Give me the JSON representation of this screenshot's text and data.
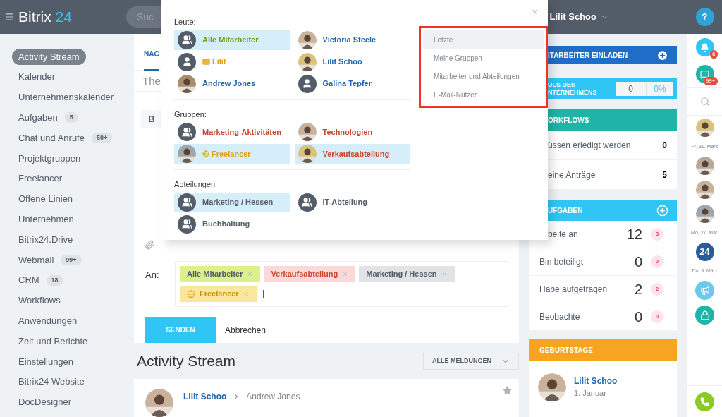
{
  "header": {
    "logo_name": "Bitrix",
    "logo_number": "24",
    "search_placeholder": "Suc",
    "user_name": "Lilit Schoo",
    "help": "?"
  },
  "sidebar": {
    "items": [
      {
        "label": "Activity Stream",
        "selected": true
      },
      {
        "label": "Kalender",
        "selected": false
      },
      {
        "label": "Unternehmenskalender",
        "selected": false
      },
      {
        "label": "Aufgaben",
        "counter": "5",
        "selected": false
      },
      {
        "label": "Chat und Anrufe",
        "counter": "50+",
        "selected": false
      },
      {
        "label": "Projektgruppen",
        "selected": false
      },
      {
        "label": "Freelancer",
        "selected": false
      },
      {
        "label": "Offene Linien",
        "selected": false
      },
      {
        "label": "Unternehmen",
        "selected": false
      },
      {
        "label": "Bitrix24.Drive",
        "selected": false
      },
      {
        "label": "Webmail",
        "counter": "99+",
        "selected": false
      },
      {
        "label": "CRM",
        "counter": "18",
        "selected": false
      },
      {
        "label": "Workflows",
        "selected": false
      },
      {
        "label": "Anwendungen",
        "selected": false
      },
      {
        "label": "Zeit und Berichte",
        "selected": false
      },
      {
        "label": "Einstellungen",
        "selected": false
      },
      {
        "label": "Bitrix24 Website",
        "selected": false
      },
      {
        "label": "DocDesigner",
        "selected": false
      }
    ]
  },
  "composer": {
    "tab": "NAC",
    "title_placeholder": "The",
    "toolbar_button": "B",
    "recipients_label": "An:",
    "recipients": [
      {
        "label": "Alle Mitarbeiter",
        "kind": "all"
      },
      {
        "label": "Verkaufsabteilung",
        "kind": "group"
      },
      {
        "label": "Marketing / Hessen",
        "kind": "department"
      },
      {
        "label": "Freelancer",
        "kind": "extranet"
      }
    ],
    "send": "SENDEN",
    "cancel": "Abbrechen"
  },
  "feed": {
    "title": "Activity Stream",
    "filter": "ALLE MELDUNGEN",
    "post": {
      "author": "Lilit Schoo",
      "recipient": "Andrew Jones"
    }
  },
  "popup": {
    "close": "×",
    "sections": [
      {
        "title": "Leute:",
        "items": [
          {
            "label": "Alle Mitarbeiter",
            "kind": "all",
            "avatar": {
              "kind": "group"
            },
            "selected": true
          },
          {
            "label": "Victoria Steele",
            "kind": "user",
            "selected": false
          },
          {
            "label": "Lilit",
            "kind": "email-user",
            "avatar": {
              "kind": "person"
            },
            "selected": false
          },
          {
            "label": "Lilit Schoo",
            "kind": "user",
            "selected": false
          },
          {
            "label": "Andrew Jones",
            "kind": "user",
            "selected": false
          },
          {
            "label": "Galina Tepfer",
            "kind": "user",
            "avatar": {
              "kind": "person"
            },
            "selected": false
          }
        ]
      },
      {
        "title": "Gruppen:",
        "items": [
          {
            "label": "Marketing-Aktivitäten",
            "kind": "group",
            "avatar": {
              "kind": "group"
            },
            "selected": false
          },
          {
            "label": "Technologien",
            "kind": "group",
            "selected": false
          },
          {
            "label": "Freelancer",
            "kind": "extranet-group",
            "selected": true
          },
          {
            "label": "Verkaufsabteilung",
            "kind": "group",
            "selected": true
          }
        ]
      },
      {
        "title": "Abteilungen:",
        "items": [
          {
            "label": "Marketing / Hessen",
            "kind": "department",
            "avatar": {
              "kind": "group"
            },
            "selected": true
          },
          {
            "label": "IT-Abteilung",
            "kind": "department",
            "avatar": {
              "kind": "group"
            },
            "selected": false
          },
          {
            "label": "Buchhaltung",
            "kind": "department",
            "avatar": {
              "kind": "group"
            },
            "selected": false
          }
        ]
      }
    ],
    "tabs": [
      {
        "label": "Letzte",
        "selected": true
      },
      {
        "label": "Meine Gruppen",
        "selected": false
      },
      {
        "label": "Mitarbeiter und Abteilungen",
        "selected": false
      },
      {
        "label": "E-Mail-Nutzer",
        "selected": false
      }
    ]
  },
  "widgets": [
    {
      "kind": "invite",
      "title": "ITARBEITER EINLADEN",
      "color": "#1e6ec8"
    },
    {
      "kind": "pulse",
      "title": "ULS DES",
      "title_2": "NTERNEHMENS",
      "value": "0",
      "percent": "0%",
      "color": "#2fc6f6"
    },
    {
      "kind": "list",
      "title": "ORKFLOWS",
      "color": "#1eb4a7",
      "rows": [
        {
          "label": "üssen erledigt werden",
          "value": "0"
        },
        {
          "label": "eine Anträge",
          "value": "5"
        }
      ]
    },
    {
      "kind": "tasks",
      "title": "UFGABEN",
      "color": "#2fc6f6",
      "rows": [
        {
          "label": "beite an",
          "value": "12",
          "badge": "3"
        },
        {
          "label": "Bin beteiligt",
          "value": "0",
          "badge": "0"
        },
        {
          "label": "Habe aufgetragen",
          "value": "2",
          "badge": "2"
        },
        {
          "label": "Beobachte",
          "value": "0",
          "badge": "0"
        }
      ]
    },
    {
      "kind": "birthdays",
      "title": "GEBURTSTAGE",
      "color": "#f7a521",
      "person": "Lilit Schoo",
      "date": "1. Januar"
    }
  ],
  "strip": [
    {
      "kind": "bell",
      "badge": "6"
    },
    {
      "kind": "chat",
      "badge": "99+"
    },
    {
      "kind": "search"
    },
    {
      "kind": "avatar"
    },
    {
      "kind": "date",
      "text": "Fr, 31. März"
    },
    {
      "kind": "avatar"
    },
    {
      "kind": "avatar"
    },
    {
      "kind": "avatar"
    },
    {
      "kind": "date",
      "text": "Mo, 27. Mär."
    },
    {
      "kind": "logo",
      "text": "24"
    },
    {
      "kind": "date",
      "text": "Do, 9. März"
    },
    {
      "kind": "megaphone"
    },
    {
      "kind": "lock"
    },
    {
      "kind": "phone"
    }
  ]
}
